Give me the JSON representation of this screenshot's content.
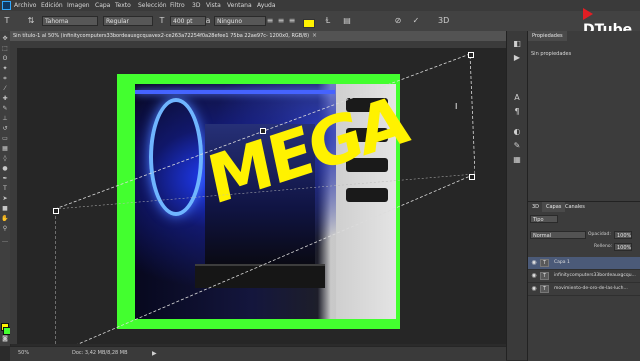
{
  "menubar": {
    "items": [
      "Archivo",
      "Edición",
      "Imagen",
      "Capa",
      "Texto",
      "Selección",
      "Filtro",
      "3D",
      "Vista",
      "Ventana",
      "Ayuda"
    ]
  },
  "options": {
    "font_family": "Tahoma",
    "font_style": "Regular",
    "font_size": "400 pt",
    "antialias": "Ninguno",
    "text_color": "#fff200"
  },
  "branding": {
    "logo_text": "DTube"
  },
  "document": {
    "tab_title": "Sin título-1 al 50% (infinitycomputers33bordeauxgcquavex2-ce263a72254f0a28efee1 75ba 22ae97c- 1200x0, RGB/8)"
  },
  "canvas": {
    "text_layer_content": "MEGA",
    "frame_color": "#43ff2f"
  },
  "status": {
    "zoom": "50%",
    "doc_info": "Doc: 3,42 MB/8,28 MB"
  },
  "properties_panel": {
    "tab": "Propiedades",
    "message": "Sin propiedades"
  },
  "layers_panel": {
    "tabs": [
      "3D",
      "Capas",
      "Canales"
    ],
    "filter": "Tipo",
    "blend_mode": "Normal",
    "opacity_label": "Opacidad:",
    "opacity_value": "100%",
    "fill_label": "Relleno:",
    "fill_value": "100%",
    "layers": [
      {
        "name": "Capa 1",
        "type": "text",
        "selected": true
      },
      {
        "name": "infinitycomputers33bordeauxgcqu...",
        "type": "text",
        "selected": false
      },
      {
        "name": "movimiento-de-oro-de-las-luch...",
        "type": "text",
        "selected": false
      }
    ]
  }
}
